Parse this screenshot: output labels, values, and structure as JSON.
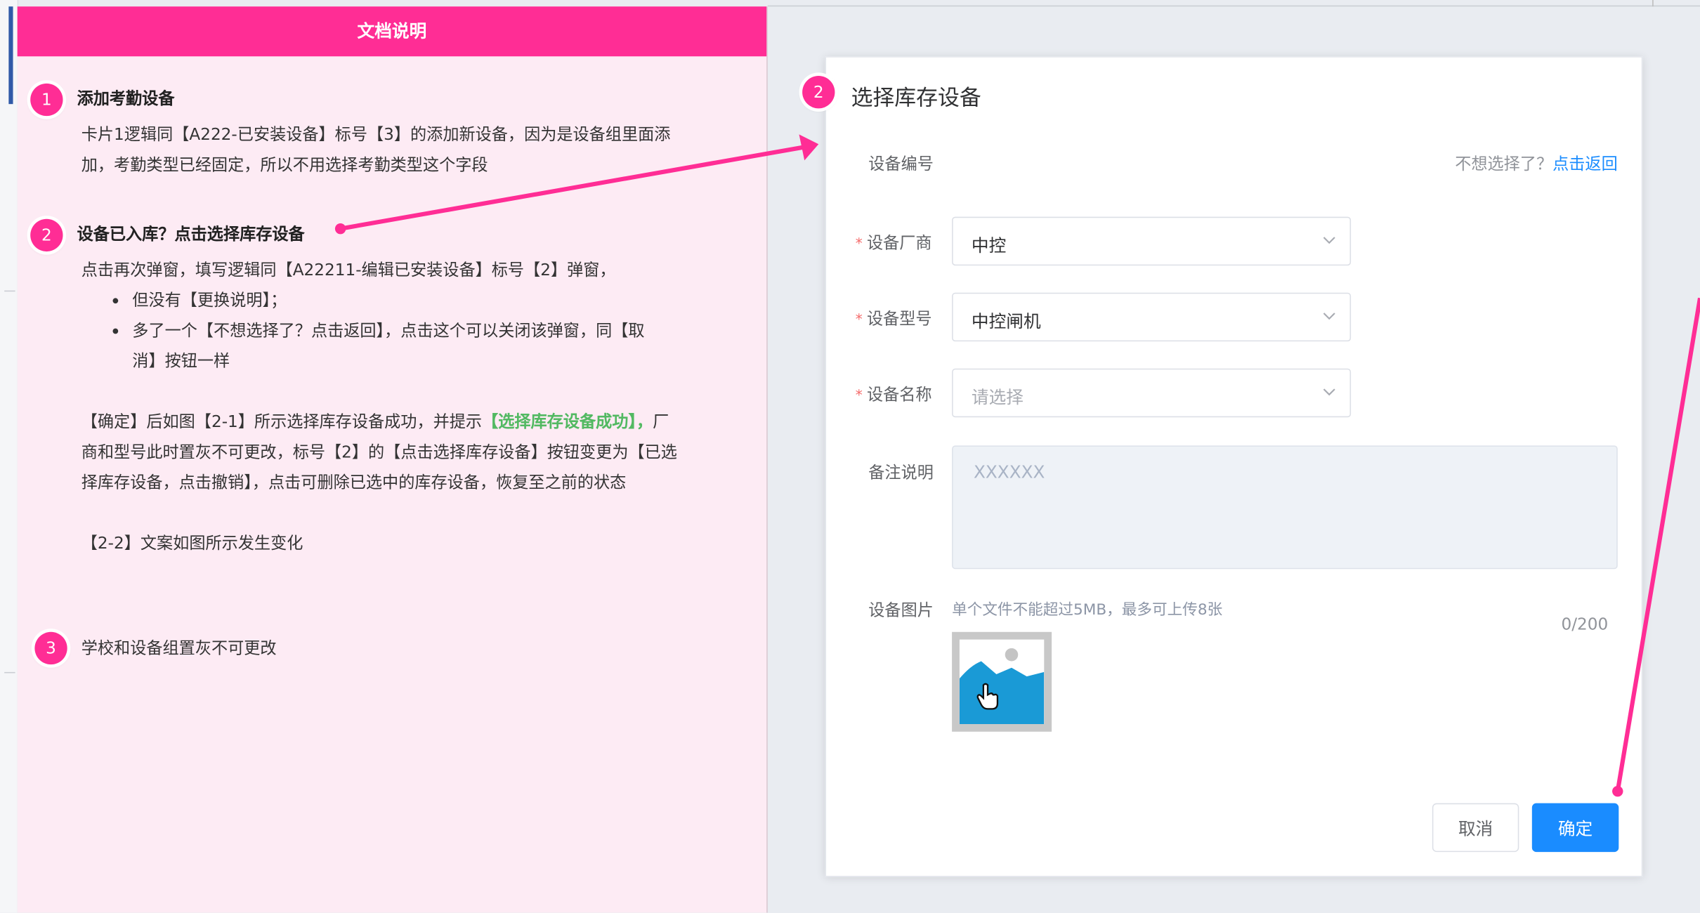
{
  "doc": {
    "header": "文档说明",
    "sections": [
      {
        "number": "1",
        "title": "添加考勤设备",
        "lines": [
          "卡片1逻辑同【A222-已安装设备】标号【3】的添加新设备，因为是设备组里面添",
          "加，考勤类型已经固定，所以不用选择考勤类型这个字段"
        ]
      },
      {
        "number": "2",
        "title": "设备已入库？点击选择库存设备",
        "intro": "点击再次弹窗，填写逻辑同【A22211-编辑已安装设备】标号【2】弹窗，",
        "bullets": [
          "但没有【更换说明】；",
          "多了一个【不想选择了？点击返回】，点击这个可以关闭该弹窗，同【取",
          "消】按钮一样"
        ],
        "para_part1": "【确定】后如图【2-1】所示选择库存设备成功，并提示",
        "para_highlight": "【选择库存设备成功】，",
        "para_part2": "厂",
        "para_lines": [
          "商和型号此时置灰不可更改，标号【2】的【点击选择库存设备】按钮变更为【已选",
          "择库存设备，点击撤销】，点击可删除已选中的库存设备，恢复至之前的状态"
        ],
        "note": "【2-2】文案如图所示发生变化"
      },
      {
        "number": "3",
        "title": "学校和设备组置灰不可更改"
      }
    ]
  },
  "dialog": {
    "badge": "2",
    "title": "选择库存设备",
    "device_no_label": "设备编号",
    "back_hint": "不想选择了？",
    "back_link": "点击返回",
    "required_mark": "*",
    "fields": {
      "vendor": {
        "label": "设备厂商",
        "value": "中控"
      },
      "model": {
        "label": "设备型号",
        "value": "中控闸机"
      },
      "name": {
        "label": "设备名称",
        "placeholder": "请选择"
      }
    },
    "remark_label": "备注说明",
    "remark_placeholder": "XXXXXX",
    "counter": "0/200",
    "image_label": "设备图片",
    "upload_hint": "单个文件不能超过5MB，最多可上传8张",
    "cancel": "取消",
    "confirm": "确定"
  },
  "colors": {
    "accent_pink": "#ff2d95",
    "primary_blue": "#1a8cff",
    "success_green": "#52b962"
  }
}
